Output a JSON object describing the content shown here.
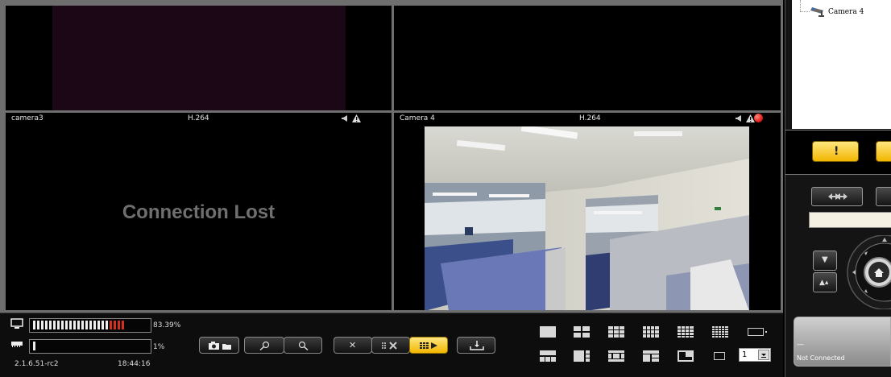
{
  "cameras": [
    {
      "name": "",
      "codec": "",
      "status": ""
    },
    {
      "name": "",
      "codec": "",
      "status": ""
    },
    {
      "name": "camera3",
      "codec": "H.264",
      "status": "Connection Lost"
    },
    {
      "name": "Camera 4",
      "codec": "H.264",
      "status": ""
    }
  ],
  "tree": {
    "camera_label": "Camera 4"
  },
  "system": {
    "cpu_percent": "83.39%",
    "cpu_value": 0.8339,
    "memory_percent": "1%",
    "memory_value": 0.01,
    "version": "2.1.6.51-rc2",
    "time": "18:44:16"
  },
  "pages": {
    "current_page": "1"
  },
  "ptz": {
    "status_dash": "—",
    "status_text": "Not Connected"
  },
  "colors": {
    "alert_yellow": "#f2c200",
    "record_red": "#e0201c",
    "meter_red": "#d2301c"
  },
  "icons": {
    "snapshot": "camera-folder-icon",
    "zoom_in": "zoom-in-icon",
    "zoom_out": "zoom-out-icon",
    "close": "close-x-icon",
    "close_all": "close-all-icon",
    "sequence": "sequence-icon",
    "download": "download-icon"
  }
}
